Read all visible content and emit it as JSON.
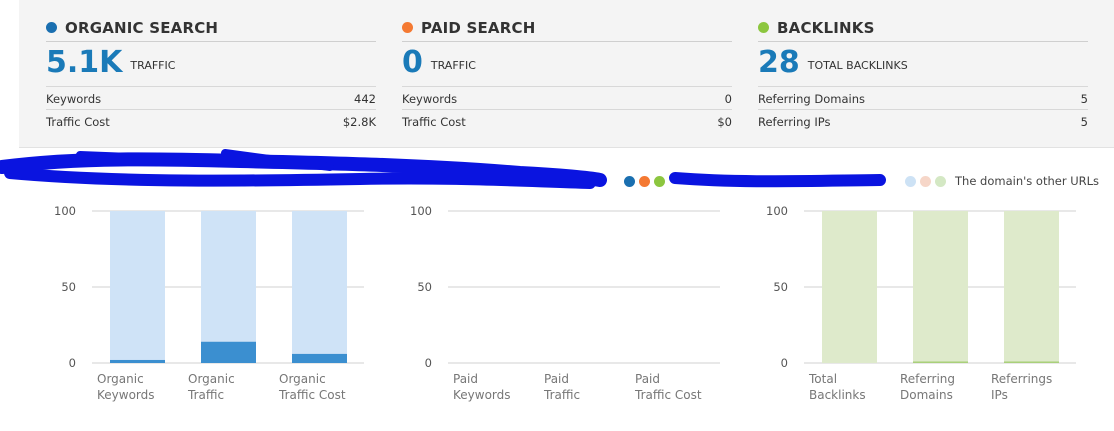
{
  "colors": {
    "organic": "#1a6fb0",
    "paid": "#f47932",
    "backlinks": "#8cc63f",
    "organic_light": "#cfe3f7",
    "organic_dark": "#3b8fd0",
    "backlinks_light": "#deeacb",
    "backlinks_dark": "#a9d07a",
    "legend_light": [
      "#cde2f5",
      "#f6d6c8",
      "#d4e8c4"
    ]
  },
  "cards": [
    {
      "title": "ORGANIC SEARCH",
      "big": "5.1K",
      "big_label": "TRAFFIC",
      "rows": [
        {
          "label": "Keywords",
          "value": "442"
        },
        {
          "label": "Traffic Cost",
          "value": "$2.8K"
        }
      ]
    },
    {
      "title": "PAID SEARCH",
      "big": "0",
      "big_label": "TRAFFIC",
      "rows": [
        {
          "label": "Keywords",
          "value": "0"
        },
        {
          "label": "Traffic Cost",
          "value": "$0"
        }
      ]
    },
    {
      "title": "BACKLINKS",
      "big": "28",
      "big_label": "TOTAL BACKLINKS",
      "rows": [
        {
          "label": "Referring Domains",
          "value": "5"
        },
        {
          "label": "Referring IPs",
          "value": "5"
        }
      ]
    }
  ],
  "legend": {
    "other_urls": "The domain's other URLs"
  },
  "chart_data": [
    {
      "type": "bar",
      "ylim": [
        0,
        100
      ],
      "yticks": [
        0,
        50,
        100
      ],
      "categories": [
        [
          "Organic",
          "Keywords"
        ],
        [
          "Organic",
          "Traffic"
        ],
        [
          "Organic",
          "Traffic Cost"
        ]
      ],
      "series": [
        {
          "values": [
            2,
            14,
            6
          ]
        },
        {
          "values": [
            98,
            86,
            94
          ]
        }
      ]
    },
    {
      "type": "bar",
      "ylim": [
        0,
        100
      ],
      "yticks": [
        0,
        50,
        100
      ],
      "categories": [
        [
          "Paid",
          "Keywords"
        ],
        [
          "Paid",
          "Traffic"
        ],
        [
          "Paid",
          "Traffic Cost"
        ]
      ],
      "series": [
        {
          "values": [
            0,
            0,
            0
          ]
        },
        {
          "values": [
            0,
            0,
            0
          ]
        }
      ]
    },
    {
      "type": "bar",
      "ylim": [
        0,
        100
      ],
      "yticks": [
        0,
        50,
        100
      ],
      "categories": [
        [
          "Total",
          "Backlinks"
        ],
        [
          "Referring",
          "Domains"
        ],
        [
          "Referrings",
          "IPs"
        ]
      ],
      "series": [
        {
          "values": [
            0,
            1,
            1
          ]
        },
        {
          "values": [
            100,
            99,
            99
          ]
        }
      ]
    }
  ]
}
